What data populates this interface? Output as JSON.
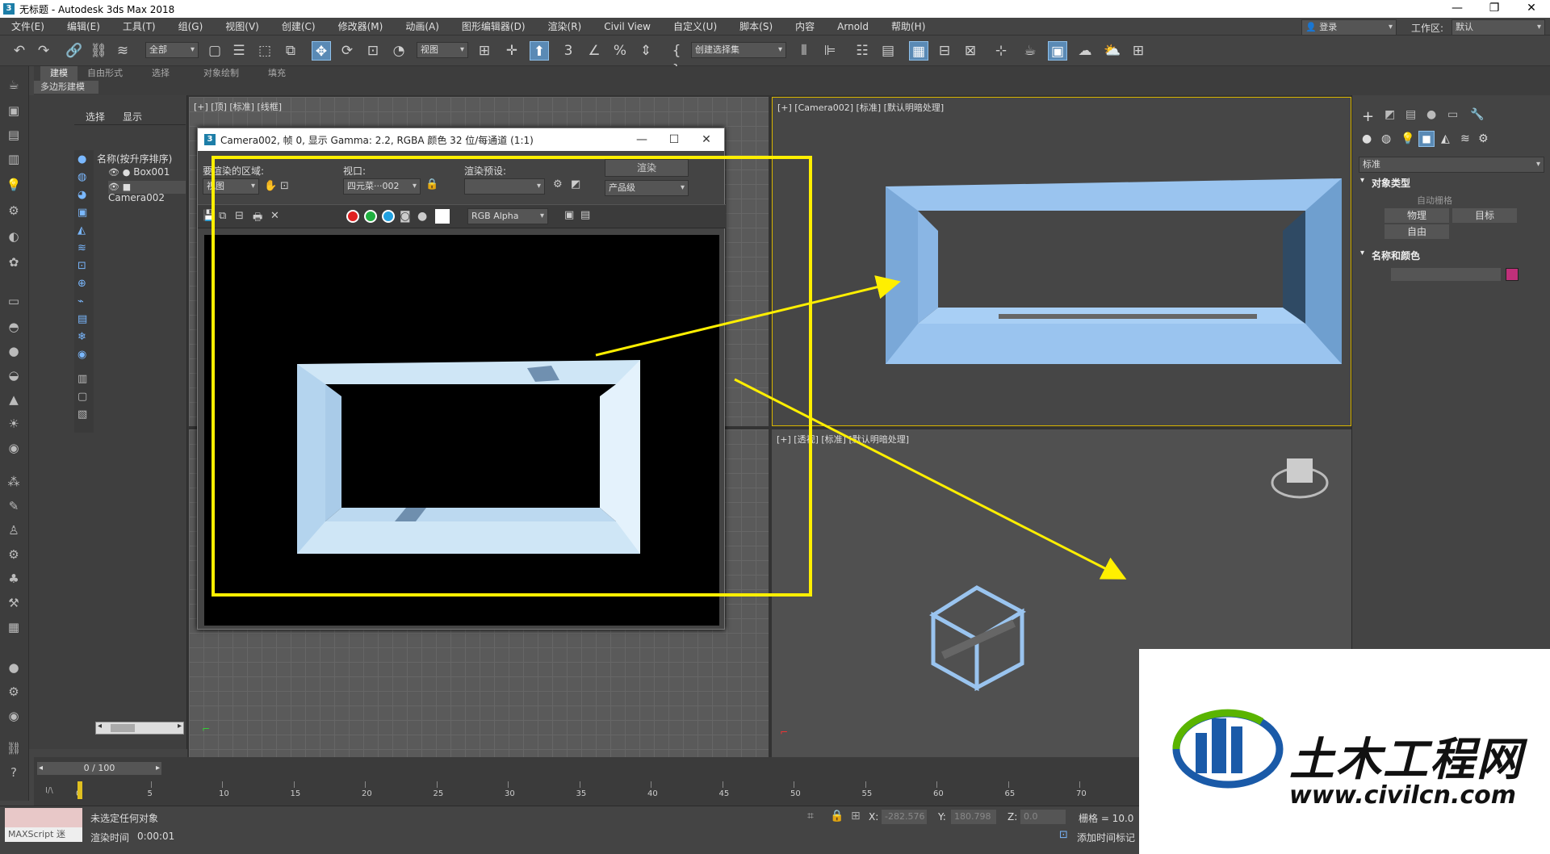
{
  "window": {
    "title": "无标题 - Autodesk 3ds Max 2018",
    "logo": "3"
  },
  "menu": [
    "文件(E)",
    "编辑(E)",
    "工具(T)",
    "组(G)",
    "视图(V)",
    "创建(C)",
    "修改器(M)",
    "动画(A)",
    "图形编辑器(D)",
    "渲染(R)",
    "Civil View",
    "自定义(U)",
    "脚本(S)",
    "内容",
    "Arnold",
    "帮助(H)"
  ],
  "account": {
    "login": "登录",
    "workspace_label": "工作区:",
    "workspace_value": "默认"
  },
  "toolbar": {
    "selection_filter": "全部",
    "coord_system": "视图",
    "named_selection": "创建选择集"
  },
  "ribbon": {
    "tabs": [
      "建模",
      "自由形式",
      "选择",
      "对象绘制",
      "填充"
    ],
    "sub": "多边形建模"
  },
  "scene": {
    "tabs": [
      "选择",
      "显示"
    ],
    "header": "名称(按升序排序)",
    "items": [
      "Box001",
      "Camera002"
    ]
  },
  "viewports": {
    "top_left": "[+] [顶] [标准] [线框]",
    "top_right": "[+] [Camera002] [标准] [默认明暗处理]",
    "bottom_right": "[+] [透视] [标准] [默认明暗处理]"
  },
  "render_window": {
    "title": "Camera002, 帧 0, 显示 Gamma: 2.2, RGBA 颜色 32 位/每通道 (1:1)",
    "area_label": "要渲染的区域:",
    "area_value": "视图",
    "viewport_label": "视口:",
    "viewport_value": "四元菜···002",
    "preset_label": "渲染预设:",
    "preset_value": "",
    "render_button": "渲染",
    "quality_value": "产品级",
    "channel_value": "RGB Alpha",
    "channel_colors": [
      "#e02020",
      "#20b040",
      "#20a0e0"
    ]
  },
  "command_panel": {
    "dropdown": "标准",
    "rollout1": "对象类型",
    "autogrid": "自动栅格",
    "buttons": [
      "物理",
      "目标",
      "自由"
    ],
    "rollout2": "名称和颜色",
    "color": "#c0307a"
  },
  "timeline": {
    "frame": "0 / 100",
    "ticks": [
      "0",
      "5",
      "10",
      "15",
      "20",
      "25",
      "30",
      "35",
      "40",
      "45",
      "50",
      "55",
      "60",
      "65",
      "70"
    ]
  },
  "status": {
    "maxscript": "MAXScript 迷",
    "message": "未选定任何对象",
    "render_time_label": "渲染时间",
    "render_time": "0:00:01",
    "x_label": "X:",
    "x_value": "-282.576",
    "y_label": "Y:",
    "y_value": "180.798",
    "z_label": "Z:",
    "z_value": "0.0",
    "grid": "栅格 = 10.0",
    "add_tag": "添加时间标记"
  },
  "watermark": {
    "cn": "土木工程网",
    "url": "www.civilcn.com"
  }
}
